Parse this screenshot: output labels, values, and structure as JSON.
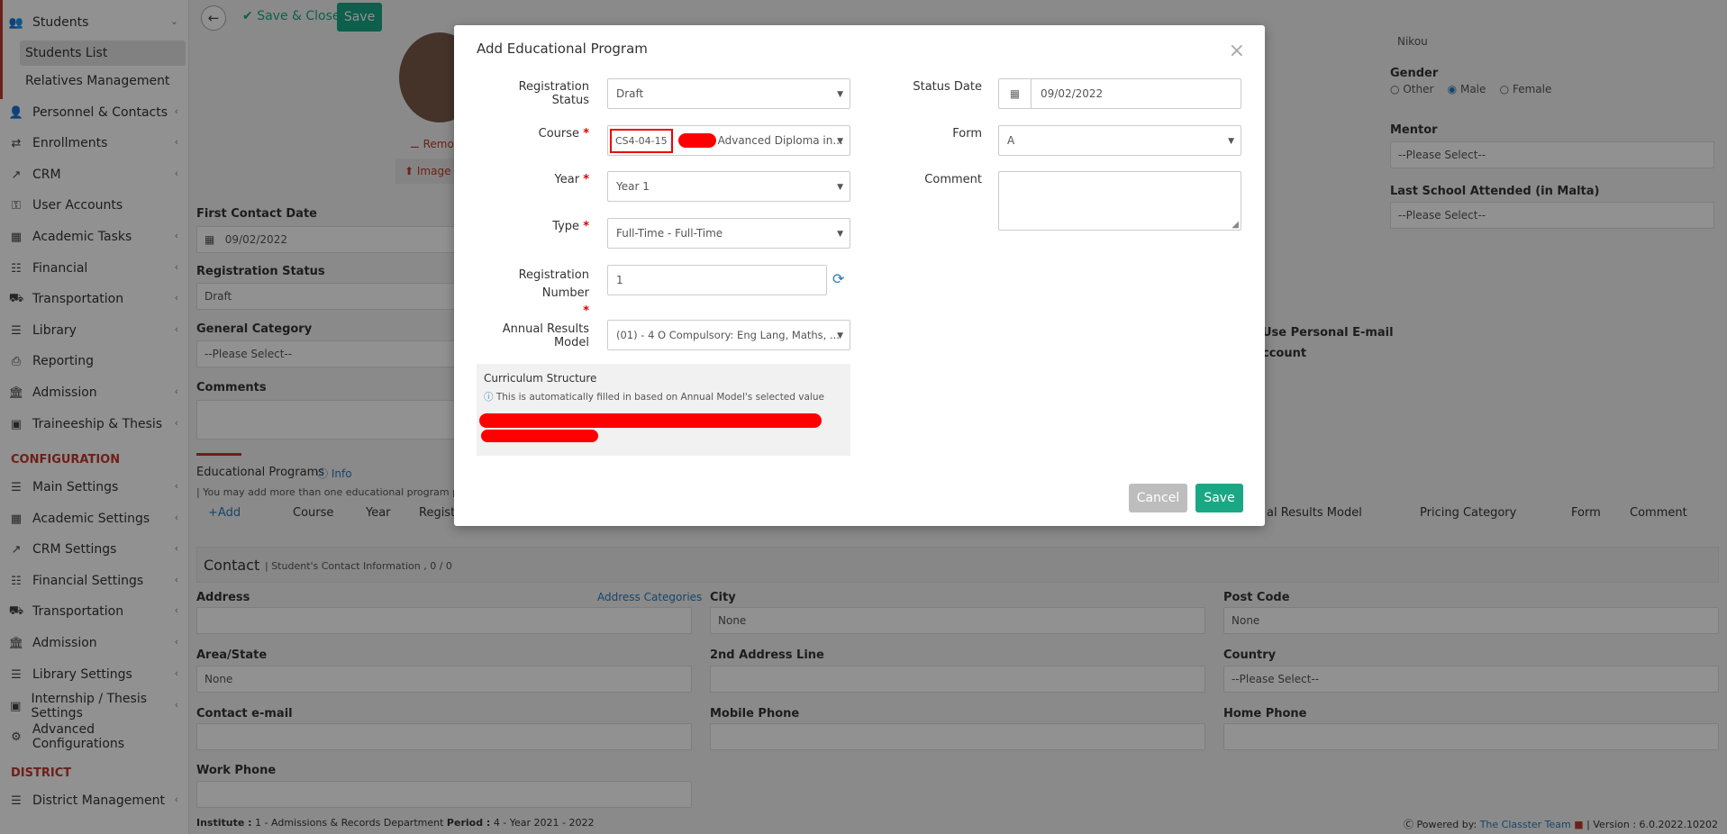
{
  "sidebar": {
    "students": "Students",
    "students_list": "Students List",
    "relatives": "Relatives Management",
    "items": [
      "Personnel & Contacts",
      "Enrollments",
      "CRM",
      "User Accounts",
      "Academic Tasks",
      "Financial",
      "Transportation",
      "Library",
      "Reporting",
      "Admission",
      "Traineeship & Thesis"
    ],
    "config_head": "CONFIGURATION",
    "config_items": [
      "Main Settings",
      "Academic Settings",
      "CRM Settings",
      "Financial Settings",
      "Transportation",
      "Admission",
      "Library Settings",
      "Internship / Thesis Settings",
      "Advanced Configurations"
    ],
    "district_head": "DISTRICT",
    "district_items": [
      "District Management"
    ]
  },
  "toolbar": {
    "save_close": "Save & Close",
    "save": "Save"
  },
  "background": {
    "remove": "Remov",
    "image": "Image",
    "first_contact_label": "First Contact Date",
    "first_contact_value": "09/02/2022",
    "reg_status_label": "Registration Status",
    "reg_status_value": "Draft",
    "general_cat_label": "General Category",
    "general_cat_value": "--Please Select--",
    "comments_label": "Comments",
    "edu_programs_label": "Educational Programs",
    "info": "Info",
    "edu_note": "| You may add more than one educational program per",
    "add": "Add",
    "cols": [
      "Course",
      "Year",
      "Registr"
    ],
    "cols_right": [
      "al Results Model",
      "Pricing Category",
      "Form",
      "Comment"
    ],
    "name_value": "Nikou",
    "gender_label": "Gender",
    "gender_options": [
      "Other",
      "Male",
      "Female"
    ],
    "mentor_label": "Mentor",
    "mentor_value": "--Please Select--",
    "last_school_label": "Last School Attended (in Malta)",
    "last_school_value": "--Please Select--",
    "use_personal": "Use Personal E-mail",
    "account": "ccount",
    "contact_title": "Contact",
    "contact_sub": "| Student's Contact Information , 0 / 0",
    "address": "Address",
    "address_cat": "Address Categories",
    "city": "City",
    "city_value": "None",
    "post_code": "Post Code",
    "post_code_value": "None",
    "area": "Area/State",
    "area_value": "None",
    "address2": "2nd Address Line",
    "country": "Country",
    "country_value": "--Please Select--",
    "contact_email": "Contact e-mail",
    "mobile": "Mobile Phone",
    "home_phone": "Home Phone",
    "work_phone": "Work Phone"
  },
  "footer": {
    "institute_label": "Institute :",
    "institute_value": "1 - Admissions & Records Department",
    "period_label": "Period :",
    "period_value": "4 - Year 2021 - 2022",
    "powered": "Powered by:",
    "team": "The Classter Team",
    "version": "| Version : 6.0.2022.10202"
  },
  "modal": {
    "title": "Add Educational Program",
    "reg_status_label": "Registration Status",
    "reg_status_value": "Draft",
    "course_label": "Course",
    "course_code": "CS4-04-15",
    "course_name": "Advanced Diploma in...",
    "year_label": "Year",
    "year_value": "Year 1",
    "type_label": "Type",
    "type_value": "Full-Time - Full-Time",
    "reg_number_label": "Registration Number",
    "reg_number_value": "1",
    "annual_label": "Annual Results Model",
    "annual_value": "(01) - 4 O Compulsory: Eng Lang, Maths, ...",
    "curriculum_title": "Curriculum Structure",
    "curriculum_note": "This is automatically filled in based on Annual Model's selected value",
    "status_date_label": "Status Date",
    "status_date_value": "09/02/2022",
    "form_label": "Form",
    "form_value": "A",
    "comment_label": "Comment",
    "cancel": "Cancel",
    "save": "Save"
  }
}
